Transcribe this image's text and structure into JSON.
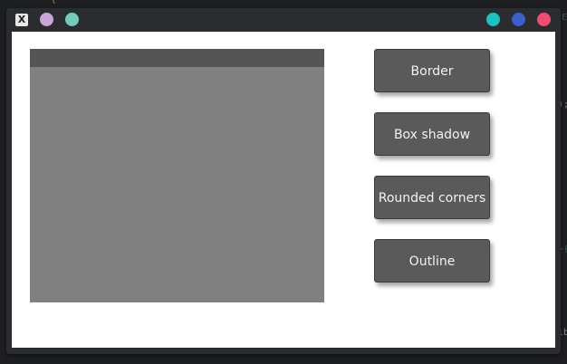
{
  "window": {
    "app_icon_glyph": "X"
  },
  "buttons": {
    "border": "Border",
    "box_shadow": "Box shadow",
    "rounded_corners": "Rounded corners",
    "outline": "Outline"
  },
  "colors": {
    "titlebar_dot_1": "#c9a6d6",
    "titlebar_dot_2": "#72cbbe",
    "titlebar_dot_3": "#19c3c3",
    "titlebar_dot_4": "#3a5fcd",
    "titlebar_dot_5": "#f24d70",
    "panel_body": "#808080",
    "panel_header": "#555555",
    "button_bg": "#5a5a5a"
  }
}
